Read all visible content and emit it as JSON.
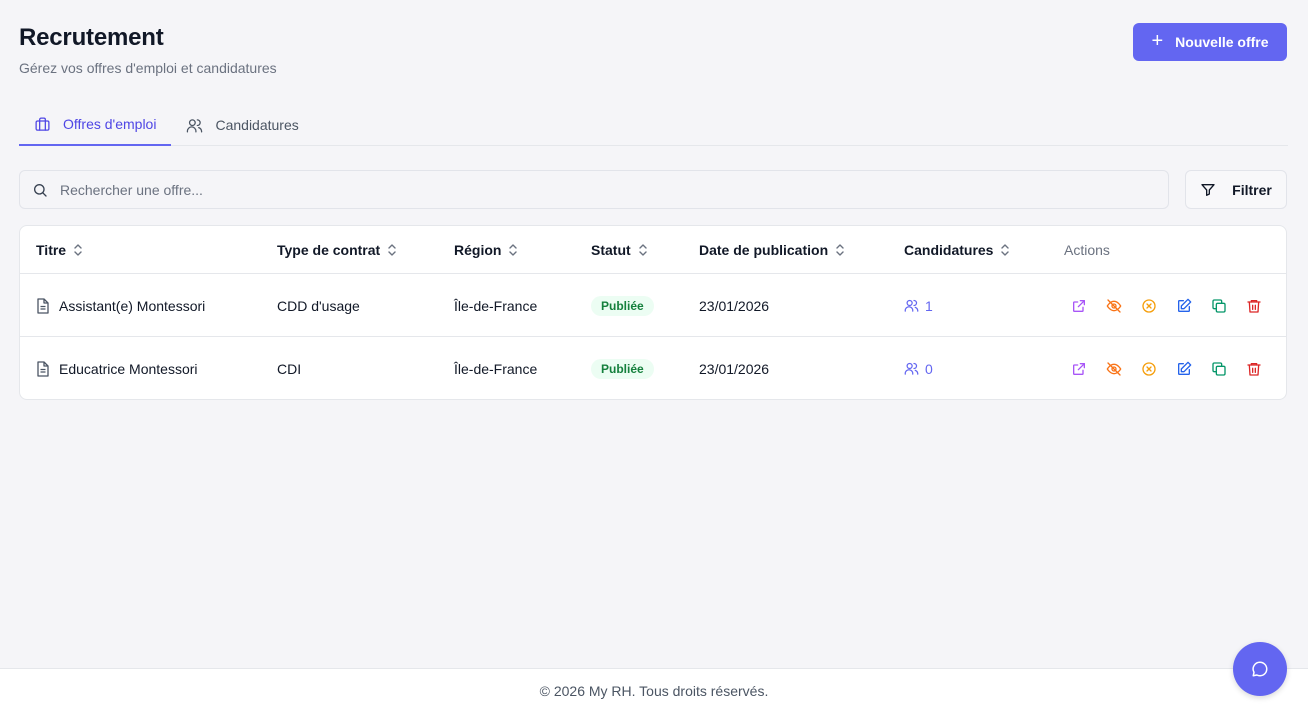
{
  "header": {
    "title": "Recrutement",
    "subtitle": "Gérez vos offres d'emploi et candidatures",
    "new_button_label": "Nouvelle offre"
  },
  "tabs": [
    {
      "label": "Offres d'emploi",
      "icon": "briefcase-icon",
      "active": true
    },
    {
      "label": "Candidatures",
      "icon": "users-icon",
      "active": false
    }
  ],
  "search": {
    "placeholder": "Rechercher une offre...",
    "value": ""
  },
  "filter": {
    "label": "Filtrer"
  },
  "table": {
    "columns": [
      "Titre",
      "Type de contrat",
      "Région",
      "Statut",
      "Date de publication",
      "Candidatures",
      "Actions"
    ],
    "rows": [
      {
        "title": "Assistant(e) Montessori",
        "contract": "CDD d'usage",
        "region": "Île-de-France",
        "status": "Publiée",
        "date": "23/01/2026",
        "applications": "1"
      },
      {
        "title": "Educatrice Montessori",
        "contract": "CDI",
        "region": "Île-de-France",
        "status": "Publiée",
        "date": "23/01/2026",
        "applications": "0"
      }
    ],
    "action_icons": [
      "external-link-icon",
      "eye-off-icon",
      "x-circle-icon",
      "edit-icon",
      "copy-icon",
      "trash-icon"
    ]
  },
  "footer": {
    "text": "© 2026 My RH. Tous droits réservés."
  },
  "colors": {
    "accent": "#6366f1",
    "status_bg": "#ecfdf3",
    "status_text": "#15803d",
    "action_link": "#a855f7",
    "action_hide": "#f97316",
    "action_close": "#f59e0b",
    "action_edit": "#2563eb",
    "action_copy": "#059669",
    "action_delete": "#dc2626"
  }
}
